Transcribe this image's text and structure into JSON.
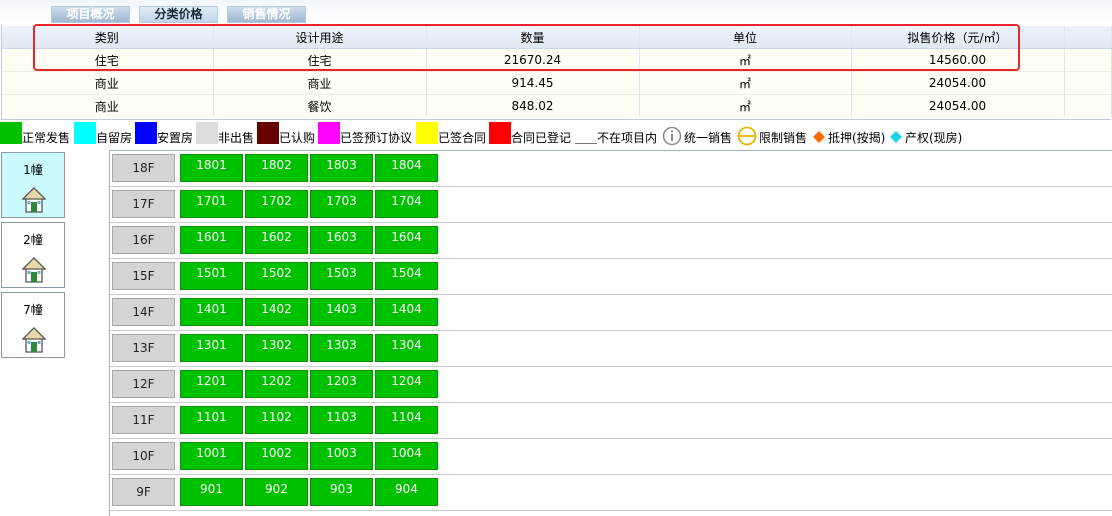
{
  "tabs": [
    {
      "label": "项目概况"
    },
    {
      "label": "分类价格"
    },
    {
      "label": "销售情况"
    }
  ],
  "price_table": {
    "headers": [
      "类别",
      "设计用途",
      "数量",
      "单位",
      "拟售价格（元/㎡）"
    ],
    "rows": [
      {
        "category": "住宅",
        "use": "住宅",
        "quantity": "21670.24",
        "unit": "㎡",
        "price": "14560.00"
      },
      {
        "category": "商业",
        "use": "商业",
        "quantity": "914.45",
        "unit": "㎡",
        "price": "24054.00"
      },
      {
        "category": "商业",
        "use": "餐饮",
        "quantity": "848.02",
        "unit": "㎡",
        "price": "24054.00"
      }
    ]
  },
  "legend": [
    {
      "label": "正常发售",
      "color": "#00c000"
    },
    {
      "label": "自留房",
      "color": "#00ffff"
    },
    {
      "label": "安置房",
      "color": "#0000ff"
    },
    {
      "label": "非出售",
      "color": "#dcdcdc"
    },
    {
      "label": "已认购",
      "color": "#660000"
    },
    {
      "label": "已签预订协议",
      "color": "#ff00ff"
    },
    {
      "label": "已签合同",
      "color": "#ffff00"
    },
    {
      "label": "合同已登记",
      "color": "#ff0000"
    },
    {
      "label": "不在项目内",
      "color": "#ffffff"
    },
    {
      "label": "统一销售",
      "icon": "info-circle-icon"
    },
    {
      "label": "限制销售",
      "icon": "restricted-circle-icon"
    },
    {
      "label": "抵押(按揭)",
      "icon": "orange-diamond-icon",
      "color": "#ff6a00"
    },
    {
      "label": "产权(现房)",
      "icon": "cyan-diamond-icon",
      "color": "#1fd6e6"
    }
  ],
  "buildings": [
    {
      "name": "1幢",
      "selected": true
    },
    {
      "name": "2幢",
      "selected": false
    },
    {
      "name": "7幢",
      "selected": false
    }
  ],
  "floors": [
    {
      "label": "18F",
      "units": [
        "1801",
        "1802",
        "1803",
        "1804"
      ]
    },
    {
      "label": "17F",
      "units": [
        "1701",
        "1702",
        "1703",
        "1704"
      ]
    },
    {
      "label": "16F",
      "units": [
        "1601",
        "1602",
        "1603",
        "1604"
      ]
    },
    {
      "label": "15F",
      "units": [
        "1501",
        "1502",
        "1503",
        "1504"
      ]
    },
    {
      "label": "14F",
      "units": [
        "1401",
        "1402",
        "1403",
        "1404"
      ]
    },
    {
      "label": "13F",
      "units": [
        "1301",
        "1302",
        "1303",
        "1304"
      ]
    },
    {
      "label": "12F",
      "units": [
        "1201",
        "1202",
        "1203",
        "1204"
      ]
    },
    {
      "label": "11F",
      "units": [
        "1101",
        "1102",
        "1103",
        "1104"
      ]
    },
    {
      "label": "10F",
      "units": [
        "1001",
        "1002",
        "1003",
        "1004"
      ]
    },
    {
      "label": "9F",
      "units": [
        "901",
        "902",
        "903",
        "904"
      ]
    }
  ],
  "colors": {
    "sale_green": "#00c100",
    "highlight_red": "#e8252a"
  }
}
